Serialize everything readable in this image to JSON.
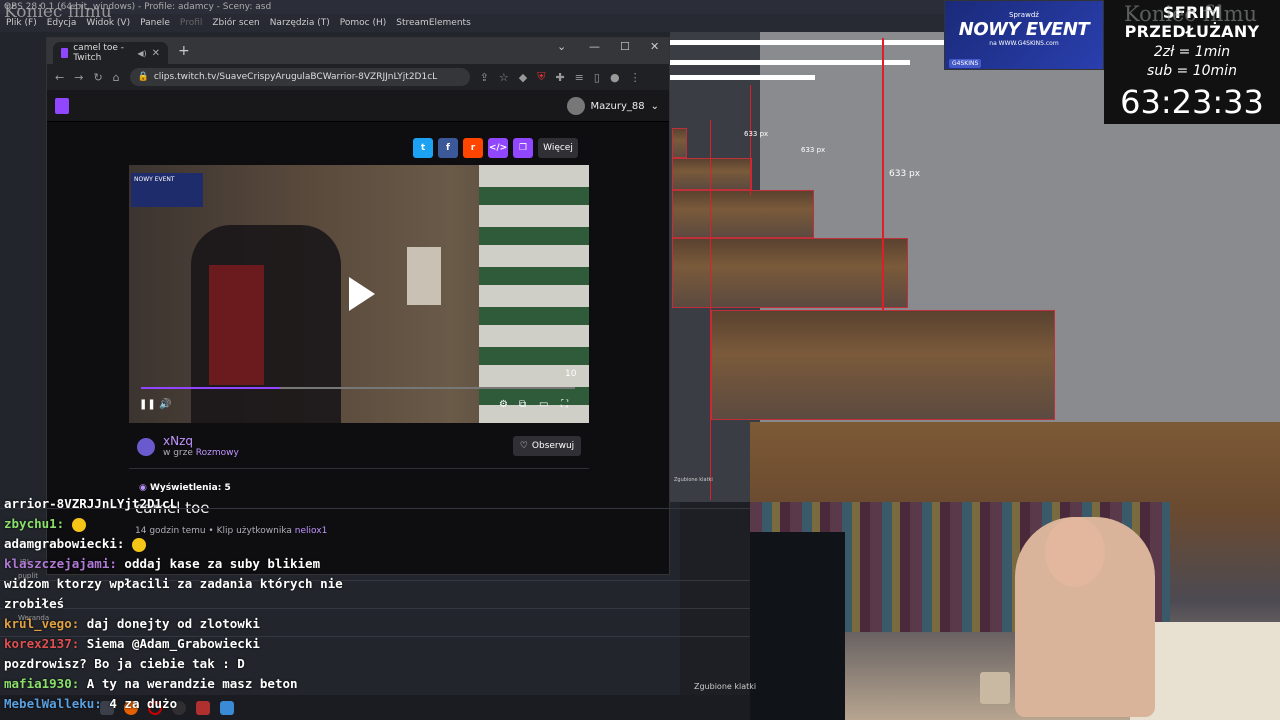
{
  "obs": {
    "title_bar": "OBS 28.0.1 (64-bit, windows) - Profile: adamcy - Sceny: asd",
    "overlay_title": "Koniec filmu",
    "menu": [
      "Plik (F)",
      "Edycja",
      "Widok (V)",
      "Panele",
      "Profil",
      "Zbiór scen",
      "Narzędzia (T)",
      "Pomoc (H)",
      "StreamElements"
    ],
    "list_labels": [
      "IRL",
      "puplit",
      "Weranda"
    ],
    "lost_frames": "Zgubione klatki",
    "lost_frames_small": "Zgubione klatki"
  },
  "browser": {
    "tab_title": "camel toe - Twitch",
    "url": "clips.twitch.tv/SuaveCrispyArugulaBCWarrior-8VZRJJnLYjt2D1cL",
    "username": "Mazury_88",
    "share_more": "Więcej"
  },
  "clip": {
    "time_remaining": "10",
    "progress": 0.32,
    "channel": "xNzq",
    "game_prefix": "w grze",
    "game": "Rozmowy",
    "follow_label": "Obserwuj",
    "views_label": "Wyświetlenia: 5",
    "title": "camel toe",
    "meta_prefix": "14 godzin temu • Klip użytkownika",
    "clipper": "neliox1",
    "mini_overlay_text": "NOWY EVENT"
  },
  "preview": {
    "size_labels": [
      "633 px",
      "633 px"
    ],
    "size_label_big": "633 px"
  },
  "ad": {
    "small": "Sprawdź",
    "big": "NOWY EVENT",
    "url": "na WWW.G4SKINS.com",
    "badge": "G4SKINS"
  },
  "timer": {
    "title": "SFRIM PRZEDŁUŻANY",
    "rule1": "2zł = 1min",
    "rule2": "sub = 10min",
    "value": "63:23:33",
    "overlay": "Koniec filmu"
  },
  "chat": [
    {
      "user": "",
      "msg": "arrior-8VZRJJnLYjt2D1cL",
      "color": "u-white"
    },
    {
      "user": "zbychu1:",
      "msg": "",
      "color": "u-green",
      "emoji": true
    },
    {
      "user": "adamgrabowiecki:",
      "msg": "",
      "color": "u-white",
      "emoji": true
    },
    {
      "user": "klaszczejajami:",
      "msg": "oddaj kase za suby blikiem",
      "color": "u-purple"
    },
    {
      "user": "",
      "msg": "widzom ktorzy wpłacili za zadania których nie",
      "color": "u-white"
    },
    {
      "user": "",
      "msg": "zrobiłeś",
      "color": "u-white"
    },
    {
      "user": "krul_vego:",
      "msg": "daj donejty od zlotowki",
      "color": "u-orange"
    },
    {
      "user": "korex2137:",
      "msg": "Siema @Adam_Grabowiecki",
      "color": "u-red"
    },
    {
      "user": "",
      "msg": "pozdrowisz? Bo ja ciebie tak : D",
      "color": "u-white"
    },
    {
      "user": "mafia1930:",
      "msg": "A ty na werandzie masz beton",
      "color": "u-green"
    },
    {
      "user": "MebelWalleku:",
      "msg": "4 za dużo",
      "color": "u-blue"
    }
  ],
  "colors": {
    "twitch_purple": "#9146ff",
    "twitter": "#1da1f2",
    "facebook": "#3b5998",
    "reddit": "#ff4500",
    "embed": "#9146ff",
    "copy": "#9146ff",
    "frame_red": "#e01e28"
  }
}
